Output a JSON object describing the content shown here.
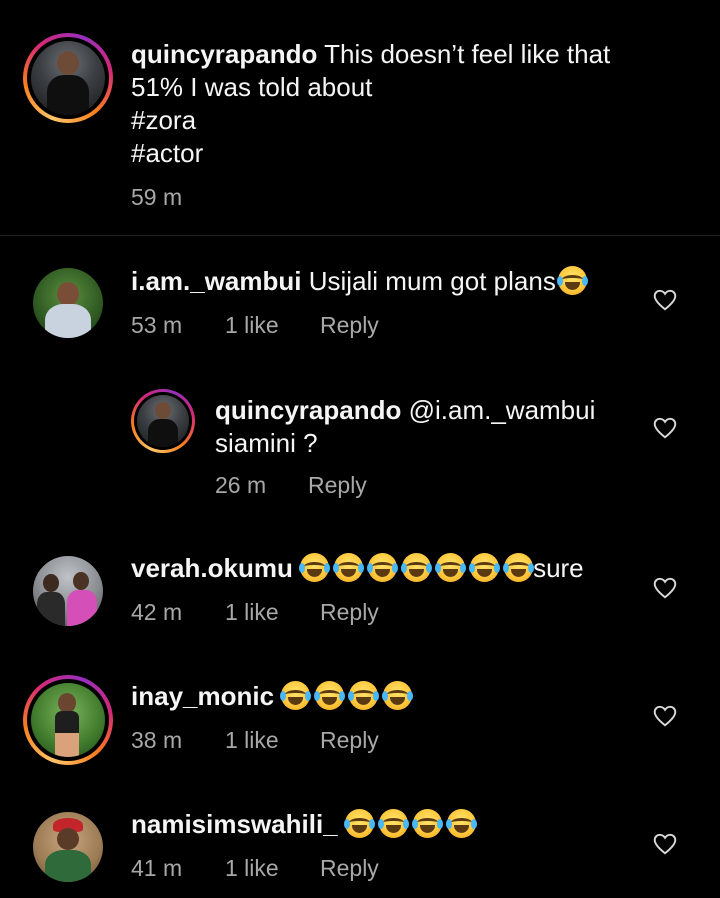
{
  "comments": [
    {
      "username": "quincyrapando",
      "text_line1": "This doesn’t feel like that",
      "text_line2": "51% I was told about",
      "text_line3": "#zora",
      "text_line4": "#actor",
      "time": "59 m"
    },
    {
      "username": "i.am._wambui",
      "text": "Usijali mum got plans",
      "emoji_count": 1,
      "time": "53 m",
      "likes": "1 like",
      "reply_label": "Reply"
    },
    {
      "username": "quincyrapando",
      "text_line1": "@i.am._wambui",
      "text_line2": "siamini ?",
      "time": "26 m",
      "reply_label": "Reply"
    },
    {
      "username": "verah.okumu",
      "emoji_count": 7,
      "text": "sure",
      "time": "42 m",
      "likes": "1 like",
      "reply_label": "Reply"
    },
    {
      "username": "inay_monic",
      "emoji_count": 4,
      "time": "38 m",
      "likes": "1 like",
      "reply_label": "Reply"
    },
    {
      "username": "namisimswahili_",
      "emoji_count": 4,
      "time": "41 m",
      "likes": "1 like",
      "reply_label": "Reply"
    }
  ],
  "icons": {
    "like": "heart-outline-icon",
    "emoji": "face-with-tears-of-joy-emoji"
  },
  "colors": {
    "background": "#000000",
    "text": "#f5f5f5",
    "meta": "#a8a8a8"
  }
}
